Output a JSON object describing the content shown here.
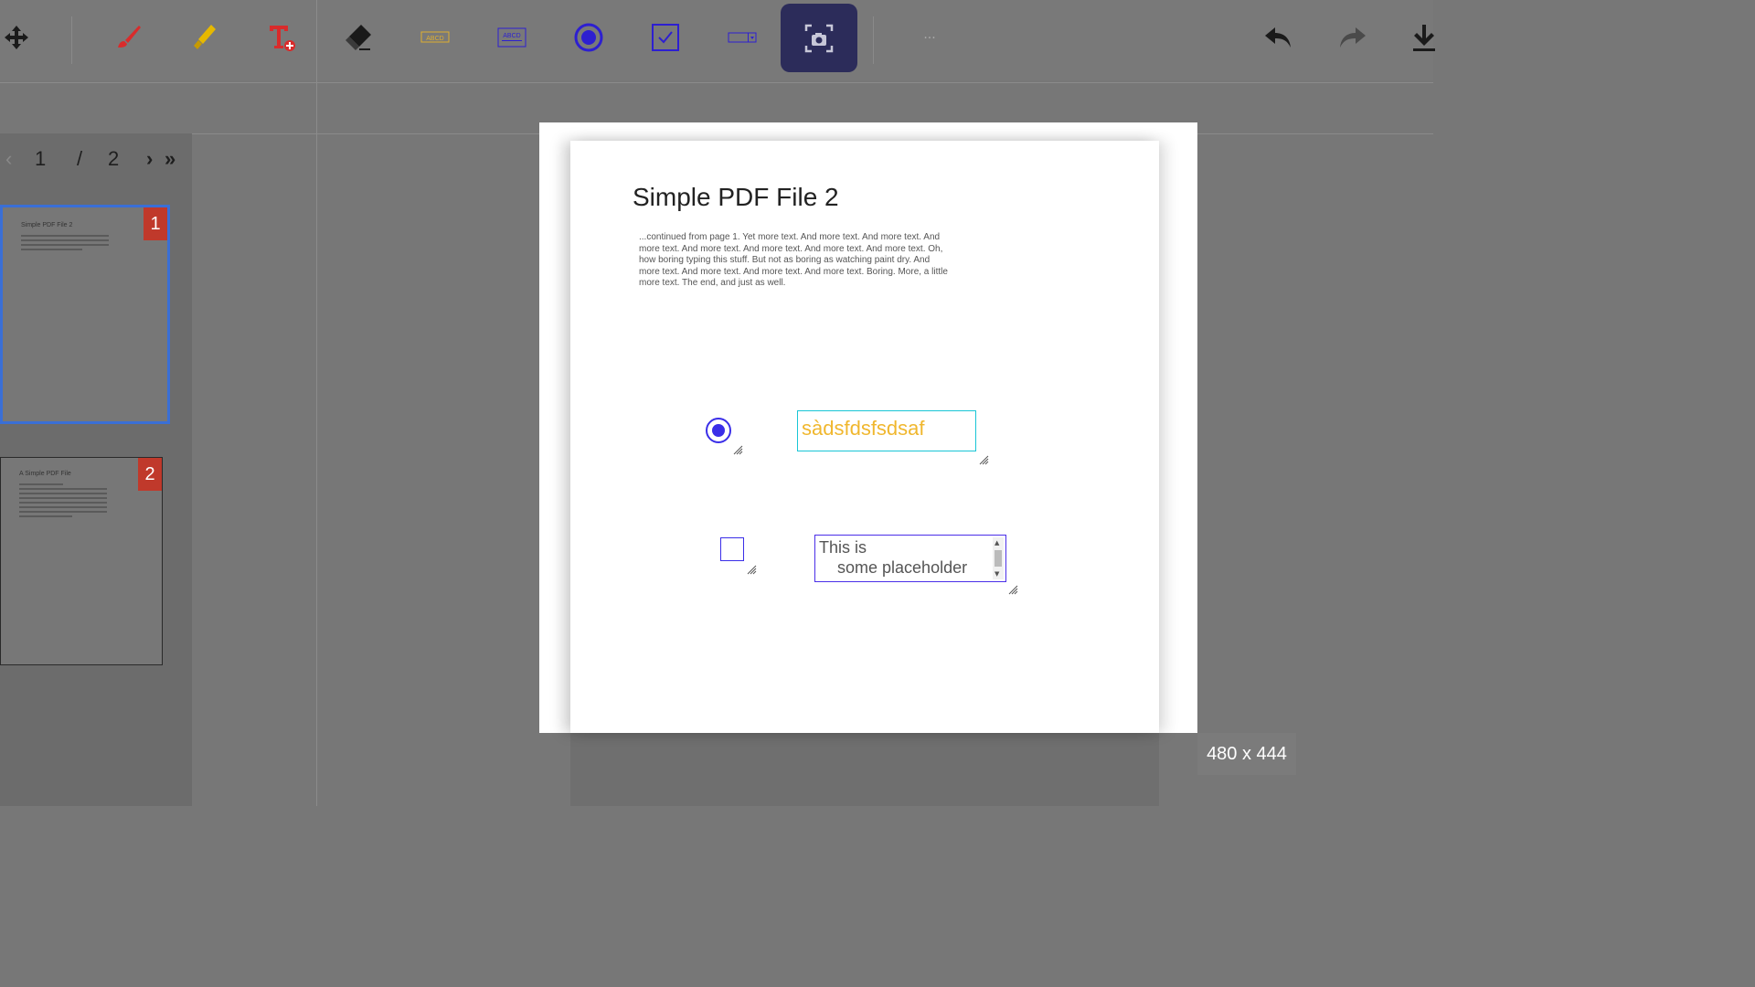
{
  "toolbar": {
    "tools": [
      {
        "name": "move-tool",
        "icon": "move-icon"
      },
      {
        "name": "brush-tool",
        "icon": "brush-icon",
        "color": "#d92b2b"
      },
      {
        "name": "highlighter-tool",
        "icon": "highlighter-icon",
        "color": "#e6b800"
      },
      {
        "name": "add-text-tool",
        "icon": "text-add-icon",
        "color": "#d92b2b"
      },
      {
        "name": "eraser-tool",
        "icon": "eraser-icon"
      },
      {
        "name": "text-field-tool",
        "icon": "text-field-icon",
        "label": "ABCD",
        "color": "#e0b030"
      },
      {
        "name": "textarea-tool",
        "icon": "textarea-icon",
        "label": "ABCD",
        "color": "#2d1fd1"
      },
      {
        "name": "radio-tool",
        "icon": "radio-icon",
        "color": "#2d1fd1"
      },
      {
        "name": "checkbox-tool",
        "icon": "checkbox-icon",
        "color": "#2d1fd1"
      },
      {
        "name": "dropdown-tool",
        "icon": "dropdown-field-icon",
        "color": "#2d1fd1"
      },
      {
        "name": "screenshot-tool",
        "icon": "screenshot-icon",
        "active": true
      }
    ],
    "more_label": "...",
    "undo_icon": "undo-icon",
    "redo_icon": "redo-icon",
    "download_icon": "download-icon"
  },
  "pager": {
    "prev": "‹",
    "current": "1",
    "separator": "/",
    "total": "2",
    "next": "›",
    "last": "»"
  },
  "thumbnails": [
    {
      "badge": "1",
      "title": "Simple PDF File 2",
      "selected": true
    },
    {
      "badge": "2",
      "title": "A Simple PDF File",
      "selected": false
    }
  ],
  "pdf": {
    "title": "Simple PDF File 2",
    "body": "...continued from page 1. Yet more text. And more text. And more text. And more text. And more text. And more text. And more text. And more text. Oh, how boring typing this stuff. But not as boring as watching paint dry. And more text. And more text. And more text. And more text. Boring.  More, a little more text. The end, and just as well."
  },
  "fields": {
    "radio_checked": true,
    "text_value": "sàdsfdsfsdsaf",
    "checkbox_checked": false,
    "textarea_value": "This is\n    some placeholder\n    text"
  },
  "selection_size": "480 x 444",
  "colors": {
    "accent": "#2c2c5a",
    "field_blue": "#3a2ee8",
    "text_field_border": "#19c6d6",
    "text_field_value": "#f0b72e",
    "badge_red": "#c0392b",
    "thumb_selected": "#3a6fd6"
  }
}
